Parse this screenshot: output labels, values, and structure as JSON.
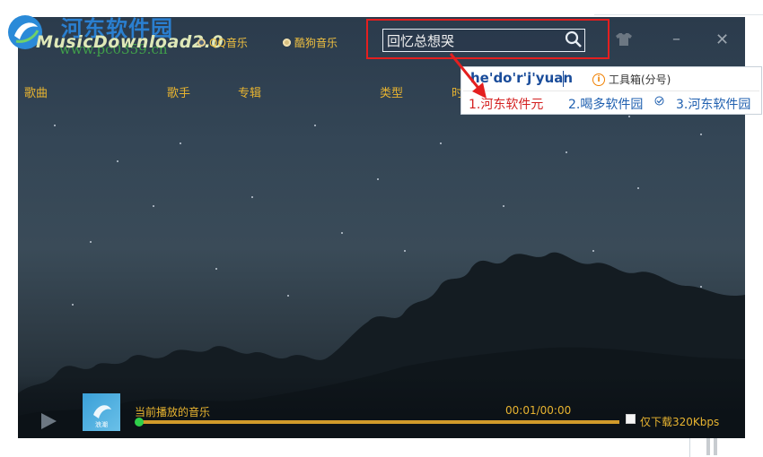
{
  "watermark": {
    "title": "河东软件园",
    "url": "www.pc0359.cn"
  },
  "app": {
    "logo_text": "MusicDownload2.0",
    "sources": [
      {
        "label": "QQ音乐",
        "selected": true
      },
      {
        "label": "酷狗音乐",
        "selected": false
      }
    ],
    "search": {
      "value": "回忆总想哭",
      "icon": "search-icon"
    },
    "controls": {
      "skin_icon": "shirt-icon",
      "minimize": "–",
      "close": "✕"
    },
    "columns": [
      "歌曲",
      "歌手",
      "专辑",
      "类型",
      "时"
    ],
    "player": {
      "now_playing_label": "当前播放的音乐",
      "cover_label": "浪潮",
      "time": "00:01/00:00",
      "progress": 0.0,
      "download_option": "仅下载320Kbps",
      "download_option_checked": false
    }
  },
  "ime": {
    "composition": "he'do'r'j'yuan",
    "toolbox_label": "工具箱(分号)",
    "candidates": [
      {
        "text": "1.河东软件元",
        "color": "#d42020"
      },
      {
        "text": "2.喝多软件园",
        "color": "#2060b0"
      },
      {
        "text": "3.河东软件园",
        "color": "#2060b0"
      }
    ]
  },
  "colors": {
    "accent": "#e8b430",
    "highlight_box": "#e41f1f",
    "progress": "#d09a2a",
    "progress_thumb": "#2fd04a"
  }
}
